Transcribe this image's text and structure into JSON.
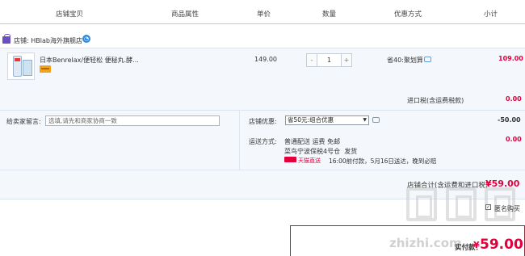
{
  "header": {
    "col_shop_item": "店铺宝贝",
    "col_attrs": "商品属性",
    "col_price": "单价",
    "col_qty": "数量",
    "col_discount": "优惠方式",
    "col_subtotal": "小计"
  },
  "shop": {
    "prefix": "店铺:",
    "name": "HBlab海外旗舰店"
  },
  "item": {
    "title": "日本Benrelax/便轻松 便秘丸.酵...",
    "price": "149.00",
    "qty_minus": "-",
    "qty_value": "1",
    "qty_plus": "+",
    "discount": "省40:聚划算",
    "subtotal": "109.00"
  },
  "import_tax": {
    "label": "进口税(含运费税款)",
    "value": "0.00"
  },
  "message": {
    "label": "给卖家留言:",
    "placeholder": "选填,请先和商家协商一致"
  },
  "shop_discount": {
    "label": "店铺优惠:",
    "selected": "省50元:组合优惠",
    "value": "-50.00"
  },
  "shipping": {
    "label": "运送方式:",
    "method": "普通配送 运费 免邮",
    "warehouse": "菜鸟宁波保税4号仓",
    "ship_note": "发货",
    "tmall_label": "天猫直送",
    "schedule": "16:00前付款，5月16日送达，晚到必赔",
    "value": "0.00"
  },
  "shop_total": {
    "label": "店铺合计(含运费和进口税)",
    "value": "¥59.00"
  },
  "anonymous": {
    "label": "匿名购买"
  },
  "payment": {
    "label": "实付款：",
    "currency": "¥",
    "value": "59.00"
  },
  "watermark": "zhizhi.com",
  "colors": {
    "accent_red": "#e4003d",
    "header_line": "#b8cbe0",
    "panel_bg": "#f4f8fd",
    "link_blue": "#2b8ae0"
  }
}
